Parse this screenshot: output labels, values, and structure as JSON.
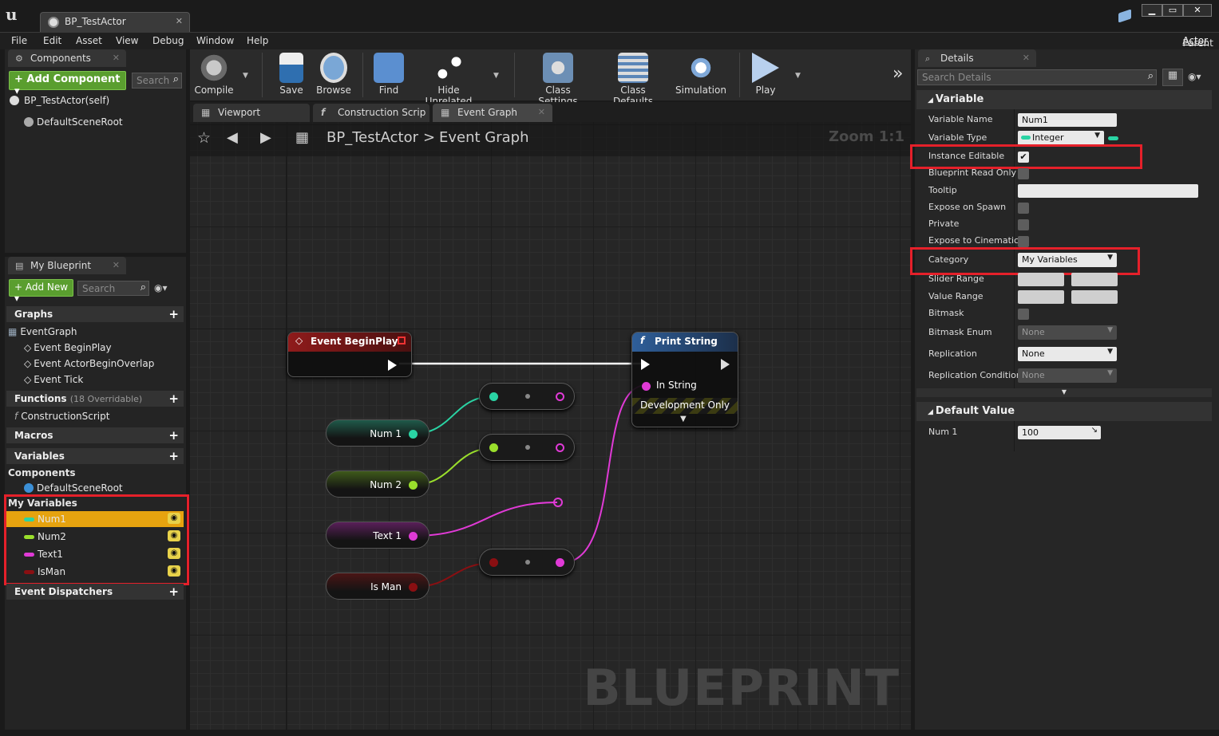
{
  "window": {
    "tab_title": "BP_TestActor",
    "buttons": [
      "▁",
      "▭",
      "✕"
    ]
  },
  "menu": [
    "File",
    "Edit",
    "Asset",
    "View",
    "Debug",
    "Window",
    "Help"
  ],
  "parent_class": {
    "label": "Parent class:",
    "value": "Actor"
  },
  "components_panel": {
    "tab": "Components",
    "add_button": "+ Add Component ▾",
    "search_placeholder": "Search",
    "items": [
      "BP_TestActor(self)",
      "DefaultSceneRoot"
    ]
  },
  "my_blueprint": {
    "tab": "My Blueprint",
    "add_new": "+ Add New ▾",
    "search_placeholder": "Search",
    "graphs_header": "Graphs",
    "graph_items": [
      "EventGraph",
      "Event BeginPlay",
      "Event ActorBeginOverlap",
      "Event Tick"
    ],
    "functions_header": "Functions",
    "functions_note": "(18 Overridable)",
    "function_items": [
      "ConstructionScript"
    ],
    "macros_header": "Macros",
    "variables_header": "Variables",
    "components_group": "Components",
    "component_vars": [
      "DefaultSceneRoot"
    ],
    "my_variables_group": "My Variables",
    "variables": [
      {
        "name": "Num1",
        "color": "#2ad4a4"
      },
      {
        "name": "Num2",
        "color": "#9adf2c"
      },
      {
        "name": "Text1",
        "color": "#e03ad6"
      },
      {
        "name": "IsMan",
        "color": "#8a0f12"
      }
    ],
    "event_dispatchers": "Event Dispatchers"
  },
  "toolbar": {
    "items": [
      {
        "label": "Compile",
        "icon": "compile-icon"
      },
      {
        "label": "Save",
        "icon": "save-icon"
      },
      {
        "label": "Browse",
        "icon": "browse-icon"
      },
      {
        "label": "Find",
        "icon": "find-icon"
      },
      {
        "label": "Hide Unrelated",
        "icon": "hide-unrelated-icon"
      },
      {
        "label": "Class Settings",
        "icon": "class-settings-icon"
      },
      {
        "label": "Class Defaults",
        "icon": "class-defaults-icon"
      },
      {
        "label": "Simulation",
        "icon": "simulation-icon"
      },
      {
        "label": "Play",
        "icon": "play-icon"
      }
    ],
    "overflow": "»"
  },
  "graph_tabs": [
    "Viewport",
    "Construction Scrip",
    "Event Graph"
  ],
  "graph": {
    "breadcrumb_root": "BP_TestActor",
    "breadcrumb_sep": ">",
    "breadcrumb_current": "Event Graph",
    "zoom": "Zoom 1:1",
    "watermark": "BLUEPRINT",
    "event_node": "Event BeginPlay",
    "print_node": "Print String",
    "print_pin": "In String",
    "dev_only": "Development Only",
    "var_nodes": [
      "Num 1",
      "Num 2",
      "Text 1",
      "Is Man"
    ]
  },
  "details": {
    "tab": "Details",
    "search_placeholder": "Search Details",
    "variable_header": "Variable",
    "rows": {
      "variable_name": {
        "label": "Variable Name",
        "value": "Num1"
      },
      "variable_type": {
        "label": "Variable Type",
        "value": "Integer"
      },
      "instance_editable": {
        "label": "Instance Editable",
        "checked": true
      },
      "blueprint_read_only": {
        "label": "Blueprint Read Only"
      },
      "tooltip": {
        "label": "Tooltip",
        "value": ""
      },
      "expose_on_spawn": {
        "label": "Expose on Spawn"
      },
      "private": {
        "label": "Private"
      },
      "expose_to_cinematics": {
        "label": "Expose to Cinematics"
      },
      "category": {
        "label": "Category",
        "value": "My Variables"
      },
      "slider_range": {
        "label": "Slider Range"
      },
      "value_range": {
        "label": "Value Range"
      },
      "bitmask": {
        "label": "Bitmask"
      },
      "bitmask_enum": {
        "label": "Bitmask Enum",
        "value": "None"
      },
      "replication": {
        "label": "Replication",
        "value": "None"
      },
      "replication_condition": {
        "label": "Replication Condition",
        "value": "None"
      }
    },
    "default_header": "Default Value",
    "default_row": {
      "label": "Num 1",
      "value": "100"
    }
  }
}
